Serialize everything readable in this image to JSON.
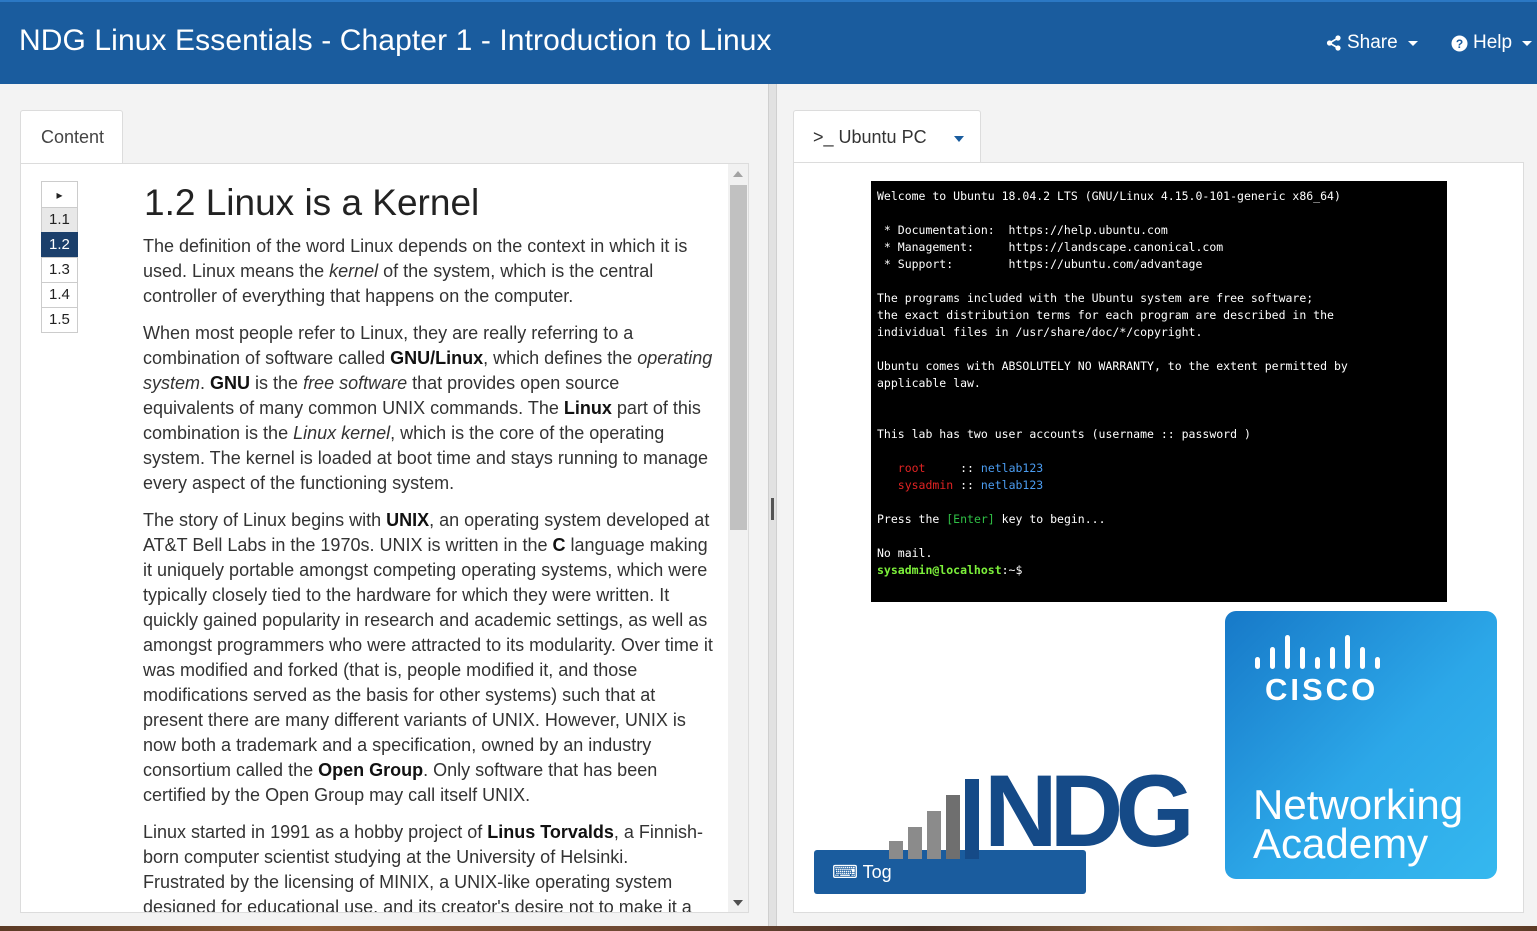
{
  "header": {
    "title": "NDG Linux Essentials - Chapter 1 - Introduction to Linux",
    "share_label": "Share",
    "help_label": "Help"
  },
  "left": {
    "tab_label": "Content",
    "pager": [
      "1.1",
      "1.2",
      "1.3",
      "1.4",
      "1.5"
    ],
    "pager_active": "1.2",
    "heading": "1.2 Linux is a Kernel",
    "paragraphs": [
      "The definition of the word Linux depends on the context in which it is used. Linux means the kernel of the system, which is the central controller of everything that happens on the computer.",
      "When most people refer to Linux, they are really referring to a combination of software called GNU/Linux, which defines the operating system. GNU is the free software that provides open source equivalents of many common UNIX commands. The Linux part of this combination is the Linux kernel, which is the core of the operating system. The kernel is loaded at boot time and stays running to manage every aspect of the functioning system.",
      "The story of Linux begins with UNIX, an operating system developed at AT&T Bell Labs in the 1970s. UNIX is written in the C language making it uniquely portable amongst competing operating systems, which were typically closely tied to the hardware for which they were written. It quickly gained popularity in research and academic settings, as well as amongst programmers who were attracted to its modularity. Over time it was modified and forked (that is, people modified it, and those modifications served as the basis for other systems) such that at present there are many different variants of UNIX. However, UNIX is now both a trademark and a specification, owned by an industry consortium called the Open Group. Only software that has been certified by the Open Group may call itself UNIX.",
      "Linux started in 1991 as a hobby project of Linus Torvalds, a Finnish-born computer scientist studying at the University of Helsinki. Frustrated by the licensing of MINIX, a UNIX-like operating system designed for educational use, and its creator's desire not to make it a"
    ]
  },
  "right": {
    "tab_label": ">_ Ubuntu PC",
    "terminal": {
      "welcome": "Welcome to Ubuntu 18.04.2 LTS (GNU/Linux 4.15.0-101-generic x86_64)",
      "doc": " * Documentation:  https://help.ubuntu.com",
      "mgmt": " * Management:     https://landscape.canonical.com",
      "support": " * Support:        https://ubuntu.com/advantage",
      "free1": "The programs included with the Ubuntu system are free software;",
      "free2": "the exact distribution terms for each program are described in the",
      "free3": "individual files in /usr/share/doc/*/copyright.",
      "warr1": "Ubuntu comes with ABSOLUTELY NO WARRANTY, to the extent permitted by",
      "warr2": "applicable law.",
      "accounts": "This lab has two user accounts (username :: password )",
      "root_user": "root",
      "sysadmin_user": "sysadmin",
      "sep": " :: ",
      "root_pw": "netlab123",
      "sysadmin_pw": "netlab123",
      "press_pre": "Press the ",
      "press_key": "[Enter]",
      "press_post": " key to begin...",
      "nomail": "No mail.",
      "prompt_user": "sysadmin@localhost",
      "prompt_rest": ":~$"
    },
    "toggle_label": "Tog",
    "ndg_logo_text": "NDG",
    "cisco_word": "CISCO",
    "academy_line1": "Networking",
    "academy_line2": "Academy"
  },
  "colors": {
    "header_bg": "#1a5c9e",
    "pager_active": "#1b3f6b",
    "ndg_blue": "#154a87",
    "cisco_blue": "#1779c8"
  }
}
